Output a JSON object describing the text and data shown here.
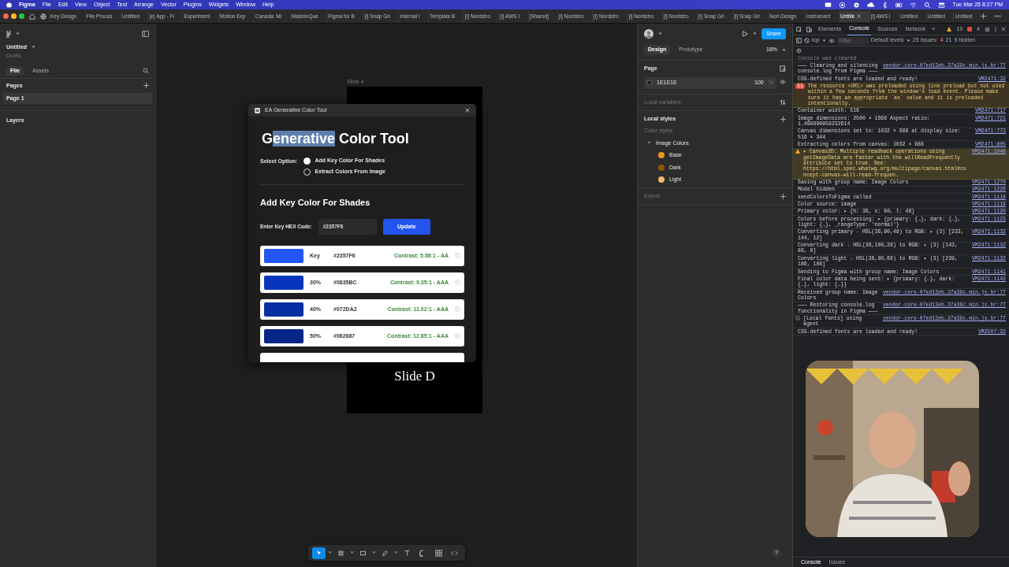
{
  "menu_bar": {
    "items": [
      {
        "label": "Figma",
        "kind": "app"
      },
      {
        "label": "File",
        "kind": "menu"
      },
      {
        "label": "Edit",
        "kind": "menu"
      },
      {
        "label": "View",
        "kind": "menu"
      },
      {
        "label": "Object",
        "kind": "menu"
      },
      {
        "label": "Text",
        "kind": "menu"
      },
      {
        "label": "Arrange",
        "kind": "menu"
      },
      {
        "label": "Vector",
        "kind": "menu"
      },
      {
        "label": "Plugins",
        "kind": "menu"
      },
      {
        "label": "Widgets",
        "kind": "menu"
      },
      {
        "label": "Window",
        "kind": "menu"
      },
      {
        "label": "Help",
        "kind": "menu"
      }
    ],
    "clock": "Tue Mar 25  8:27 PM"
  },
  "browser_tabs": [
    {
      "label": "Key Design",
      "selected": false
    },
    {
      "label": "File Proces",
      "selected": false
    },
    {
      "label": "Untitled",
      "selected": false
    },
    {
      "label": "[e] App - Fi",
      "selected": false
    },
    {
      "label": "Experiment",
      "selected": false
    },
    {
      "label": "Motion Exp",
      "selected": false
    },
    {
      "label": "Canada: Mi",
      "selected": false
    },
    {
      "label": "MadeInQue",
      "selected": false
    },
    {
      "label": "Figma for B",
      "selected": false
    },
    {
      "label": "[i] Snap Gri",
      "selected": false
    },
    {
      "label": "Internal i",
      "selected": false
    },
    {
      "label": "Template B",
      "selected": false
    },
    {
      "label": "[i] Nordstro",
      "selected": false
    },
    {
      "label": "[i] AWS I",
      "selected": false
    },
    {
      "label": "[Shared]",
      "selected": false
    },
    {
      "label": "[i] Nordstro",
      "selected": false
    },
    {
      "label": "[i] Nordstro",
      "selected": false
    },
    {
      "label": "[i] Nordstro",
      "selected": false
    },
    {
      "label": "[i] Nordstro",
      "selected": false
    },
    {
      "label": "[i] Snap Gri",
      "selected": false
    },
    {
      "label": "[i] Snap Gri",
      "selected": false
    },
    {
      "label": "Nori Design",
      "selected": false
    },
    {
      "label": "Instrument",
      "selected": false
    },
    {
      "label": "Untitle",
      "selected": true
    },
    {
      "label": "[i] AWS I",
      "selected": false
    },
    {
      "label": "Untitled",
      "selected": false
    },
    {
      "label": "Untitled",
      "selected": false
    },
    {
      "label": "Untitled",
      "selected": false
    }
  ],
  "left_panel": {
    "file_name": "Untitled",
    "location": "Drafts",
    "tabs": [
      {
        "label": "File",
        "selected": true
      },
      {
        "label": "Assets",
        "selected": false
      }
    ],
    "pages_heading": "Pages",
    "pages": [
      {
        "label": "Page 1",
        "selected": true
      }
    ],
    "layers_heading": "Layers"
  },
  "canvas": {
    "frame_label": "Slide 4",
    "frame_text": "Slide D"
  },
  "plugin": {
    "window_title": "EA Generative Color Tool",
    "title_parts": [
      {
        "text": "G",
        "selected": false
      },
      {
        "text": "enerative",
        "selected": true
      },
      {
        "text": " Color Tool",
        "selected": false
      }
    ],
    "option_label": "Select Option:",
    "options": [
      {
        "label": "Add Key Color For Shades",
        "selected": true
      },
      {
        "label": "Extract Colors From Image",
        "selected": false
      }
    ],
    "section_title": "Add Key Color For Shades",
    "hex_label": "Enter Key HEX Code:",
    "hex_value": "#2357F6",
    "update_button": "Update",
    "shades": [
      {
        "label": "Key",
        "hex": "#2357F6",
        "contrast": "Contrast: 5.58:1 - AA",
        "color": "#2357f6"
      },
      {
        "label": "30%",
        "hex": "#0835BC",
        "contrast": "Contrast: 9.35:1 - AAA",
        "color": "#0835bc"
      },
      {
        "label": "40%",
        "hex": "#072DA2",
        "contrast": "Contrast: 11.02:1 - AAA",
        "color": "#072da2"
      },
      {
        "label": "50%",
        "hex": "#062687",
        "contrast": "Contrast: 12.85:1 - AAA",
        "color": "#062687"
      }
    ]
  },
  "toolbar": {
    "tools": [
      {
        "kind": "move",
        "selected": true,
        "has_menu": true
      },
      {
        "kind": "frame",
        "selected": false,
        "has_menu": true
      },
      {
        "kind": "rectangle",
        "selected": false,
        "has_menu": true
      },
      {
        "kind": "pen",
        "selected": false,
        "has_menu": true
      },
      {
        "kind": "text",
        "selected": false,
        "has_menu": false
      },
      {
        "kind": "comment",
        "selected": false,
        "has_menu": false
      },
      {
        "kind": "actions",
        "selected": false,
        "has_menu": false
      },
      {
        "kind": "code",
        "selected": false,
        "has_menu": false
      }
    ]
  },
  "design_panel": {
    "share_button": "Share",
    "tabs": [
      {
        "label": "Design",
        "selected": true
      },
      {
        "label": "Prototype",
        "selected": false
      }
    ],
    "zoom": "18%",
    "page_heading": "Page",
    "page_fill": {
      "hex": "1E1E1E",
      "opacity": "100",
      "unit": "%",
      "color": "#1e1e1e"
    },
    "local_variables": "Local variables",
    "local_styles": "Local styles",
    "color_styles": "Color styles",
    "style_group": {
      "name": "Image Colors",
      "expanded": true,
      "styles": [
        {
          "name": "Base",
          "color": "#e89a1c"
        },
        {
          "name": "Dark",
          "color": "#8f5600"
        },
        {
          "name": "Light",
          "color": "#efba6c"
        }
      ]
    },
    "export": "Export",
    "help": "?"
  },
  "devtools": {
    "tabs": [
      {
        "label": "Elements",
        "selected": false
      },
      {
        "label": "Console",
        "selected": true
      },
      {
        "label": "Sources",
        "selected": false
      },
      {
        "label": "Network",
        "selected": false
      }
    ],
    "more_tabs": "»",
    "warning_count": "19",
    "error_count": "4",
    "context": "top",
    "filter_placeholder": "Filter",
    "levels": "Default levels",
    "issues_label": "25 Issues:",
    "issues_errors": "4",
    "issues_info": "21",
    "hidden": "9 hidden",
    "log": [
      {
        "kind": "cleared",
        "text": "Console was cleared"
      },
      {
        "kind": "log",
        "text": "——— Clearing and silencing console.log from Figma ———",
        "source": "vendor-core-07ed13eb…37a39c.min.js.br:77"
      },
      {
        "kind": "log",
        "text": "CSS-defined fonts are loaded and ready!",
        "source": "VM2471:32"
      },
      {
        "kind": "error",
        "badge": "11",
        "text": "The resource <URL> was preloaded using link preload but not used within a few seconds from the window's load event. Please make sure it has an appropriate `as` value and it is preloaded intentionally."
      },
      {
        "kind": "log",
        "text": "Container width: 516",
        "source": "VM2471:717"
      },
      {
        "kind": "log",
        "text": "Image dimensions: 2500 × 1668 Aspect ratio: 1.498800959232614",
        "source": "VM2471:721"
      },
      {
        "kind": "log",
        "text": "Canvas dimensions set to: 1032 × 688 at display size: 516 × 344",
        "source": "VM2471:773"
      },
      {
        "kind": "log",
        "text": "Extracting colors from canvas: 1032 × 688",
        "source": "VM2471:805"
      },
      {
        "kind": "warning",
        "text": "▸ Canvas2D: Multiple readback operations using getImageData are faster with the willReadFrequently attribute set to true. See: https://html.spec.whatwg.org/multipage/canvas.html#concept-canvas-will-read-frequen…",
        "source": "VM2471:1040"
      },
      {
        "kind": "log",
        "text": "Saving with group name: Image Colors",
        "source": "VM2471:1270"
      },
      {
        "kind": "log",
        "text": "Model hidden",
        "source": "VM2471:1226"
      },
      {
        "kind": "log",
        "text": "sendColorsToFigma called",
        "source": "VM2471:1118"
      },
      {
        "kind": "log",
        "text": "Color source: image",
        "source": "VM2471:1119"
      },
      {
        "kind": "log",
        "text": "Primary color: ▸ {h: 36, s: 90, l: 48}",
        "source": "VM2471:1120"
      },
      {
        "kind": "log",
        "text": "Colors before processing: ▸ {primary: {…}, dark: {…}, light: {…}, _rangeType: 'normal'}",
        "source": "VM2471:1123"
      },
      {
        "kind": "log",
        "text": "Converting primary - HSL(36,90,48) to RGB: ▸ (3) [233, 144, 12]",
        "source": "VM2471:1132"
      },
      {
        "kind": "log",
        "text": "Converting dark - HSL(36,100,28) to RGB: ▸ (3) [143, 86, 0]",
        "source": "VM2471:1132"
      },
      {
        "kind": "log",
        "text": "Converting light - HSL(36,80,68) to RGB: ▸ (3) [239, 186, 108]",
        "source": "VM2471:1132"
      },
      {
        "kind": "log",
        "text": "Sending to Figma with group name: Image Colors",
        "source": "VM2471:1141"
      },
      {
        "kind": "log",
        "text": "Final color data being sent: ▸ {primary: {…}, dark: {…}, light: {…}}",
        "source": "VM2471:1142"
      },
      {
        "kind": "log",
        "text": "Received group name: Image Colors",
        "source": "vendor-core-07ed13eb…37a39c.min.js.br:77"
      },
      {
        "kind": "log",
        "text": "——— Restoring console.log functionality in Figma ———",
        "source": "vendor-core-07ed13eb…37a39c.min.js.br:77"
      },
      {
        "kind": "info",
        "text": "[Local fonts] using agent",
        "source": "vendor-core-07ed13eb…37a39c.min.js.br:77"
      },
      {
        "kind": "log",
        "text": "CSS-defined fonts are loaded and ready!",
        "source": "VM2507:32"
      }
    ],
    "drawer_tabs": [
      {
        "label": "Console",
        "selected": true
      },
      {
        "label": "Issues",
        "selected": false
      }
    ]
  }
}
